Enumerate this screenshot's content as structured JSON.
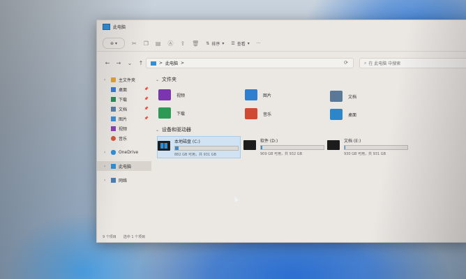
{
  "window": {
    "title": "此电脑",
    "toolbar": {
      "new_label": "",
      "sort_label": "排序",
      "view_label": "查看",
      "more_label": "···"
    },
    "address": {
      "path": "此电脑",
      "separator": ">"
    },
    "search": {
      "placeholder": "在 此电脑 中搜索"
    }
  },
  "sidebar": {
    "quick_access": "主文件夹",
    "items": [
      {
        "label": "桌面",
        "color": "#3a7bd5"
      },
      {
        "label": "下载",
        "color": "#2e8b57"
      },
      {
        "label": "文档",
        "color": "#5b7fa6"
      },
      {
        "label": "图片",
        "color": "#3b8fd6"
      },
      {
        "label": "视频",
        "color": "#8b3fb5"
      },
      {
        "label": "音乐",
        "color": "#d3573a"
      }
    ],
    "onedrive": "OneDrive",
    "this_pc": "此电脑",
    "network": "网络"
  },
  "folders_section": {
    "header": "文件夹",
    "folders": [
      {
        "label": "视频",
        "icon": "video-folder-icon",
        "color": "#7b35b0"
      },
      {
        "label": "图片",
        "icon": "pictures-folder-icon",
        "color": "#2f7fd0"
      },
      {
        "label": "文档",
        "icon": "documents-folder-icon",
        "color": "#5a7898"
      },
      {
        "label": "下载",
        "icon": "downloads-folder-icon",
        "color": "#2c9a55"
      },
      {
        "label": "音乐",
        "icon": "music-folder-icon",
        "color": "#d04a33"
      },
      {
        "label": "桌面",
        "icon": "desktop-folder-icon",
        "color": "#2d86c9"
      }
    ]
  },
  "drives_section": {
    "header": "设备和驱动器",
    "drives": [
      {
        "name": "本地磁盘 (C:)",
        "free": "882 GB 可用，共 931 GB",
        "used_fraction": 0.05,
        "selected": true
      },
      {
        "name": "软件 (D:)",
        "free": "909 GB 可用，共 932 GB",
        "used_fraction": 0.02,
        "selected": false
      },
      {
        "name": "文档 (E:)",
        "free": "930 GB 可用，共 931 GB",
        "used_fraction": 0.01,
        "selected": false
      }
    ]
  },
  "status": {
    "item_count": "9 个项目",
    "selection": "选中 1 个项目"
  }
}
